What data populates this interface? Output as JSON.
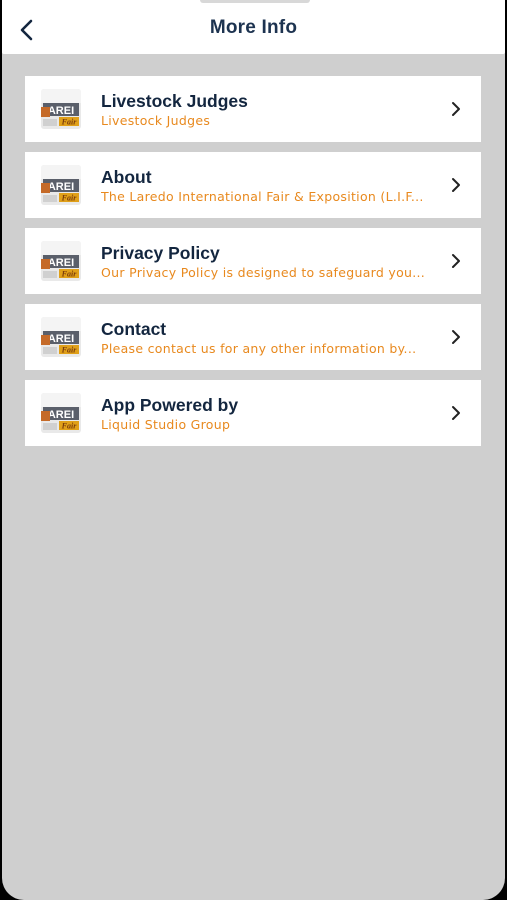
{
  "header": {
    "title": "More Info",
    "back_icon": "chevron-left-icon"
  },
  "items": [
    {
      "title": "Livestock Judges",
      "subtitle": "Livestock Judges",
      "thumbnail": "laredo-fair-logo"
    },
    {
      "title": "About",
      "subtitle": "The Laredo International Fair & Exposition (L.I.F...",
      "thumbnail": "laredo-fair-logo"
    },
    {
      "title": "Privacy Policy",
      "subtitle": "Our Privacy Policy is designed to safeguard you...",
      "thumbnail": "laredo-fair-logo"
    },
    {
      "title": "Contact",
      "subtitle": "Please contact us for any other information by...",
      "thumbnail": "laredo-fair-logo"
    },
    {
      "title": "App Powered by",
      "subtitle": "Liquid Studio Group",
      "thumbnail": "laredo-fair-logo"
    }
  ],
  "colors": {
    "title": "#13263f",
    "subtitle": "#e8891e",
    "background": "#cfcfcf"
  }
}
